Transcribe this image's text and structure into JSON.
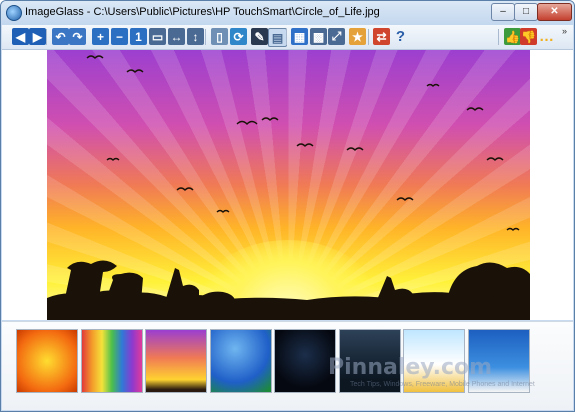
{
  "window": {
    "title": "ImageGlass - C:\\Users\\Public\\Pictures\\HP TouchSmart\\Circle_of_Life.jpg",
    "minimize_glyph": "–",
    "maximize_glyph": "□",
    "close_glyph": "✕"
  },
  "toolbar": {
    "overflow_glyph": "»",
    "buttons": [
      {
        "name": "back-icon",
        "glyph": "◀",
        "color": "#1f5fb5"
      },
      {
        "name": "forward-icon",
        "glyph": "▶",
        "color": "#1f5fb5"
      },
      {
        "name": "rotate-left-icon",
        "glyph": "↶",
        "color": "#3a76c4"
      },
      {
        "name": "rotate-right-icon",
        "glyph": "↷",
        "color": "#3a76c4"
      },
      {
        "name": "zoom-in-icon",
        "glyph": "+",
        "color": "#2b6fc2"
      },
      {
        "name": "zoom-out-icon",
        "glyph": "−",
        "color": "#2b6fc2"
      },
      {
        "name": "actual-size-icon",
        "glyph": "1",
        "color": "#2b6fc2"
      },
      {
        "name": "lock-zoom-icon",
        "glyph": "▭",
        "color": "#4a6a93"
      },
      {
        "name": "fit-width-icon",
        "glyph": "↔",
        "color": "#4a6a93"
      },
      {
        "name": "fit-height-icon",
        "glyph": "↕",
        "color": "#4a6a93"
      },
      {
        "name": "open-folder-icon",
        "glyph": "▯",
        "color": "#6f8fb5"
      },
      {
        "name": "refresh-icon",
        "glyph": "⟳",
        "color": "#2f86c9"
      },
      {
        "name": "edit-icon",
        "glyph": "✎",
        "color": "#2a3950"
      },
      {
        "name": "view-mode-icon",
        "glyph": "▤",
        "color": "#4a6a93"
      },
      {
        "name": "thumbnail-grid-icon",
        "glyph": "▦",
        "color": "#2f70c8"
      },
      {
        "name": "checkerboard-icon",
        "glyph": "▩",
        "color": "#4a6a93"
      },
      {
        "name": "fullscreen-icon",
        "glyph": "⤢",
        "color": "#4a6a93"
      },
      {
        "name": "slideshow-icon",
        "glyph": "★",
        "color": "#e6a23a"
      },
      {
        "name": "convert-icon",
        "glyph": "⇄",
        "color": "#d0452d"
      },
      {
        "name": "help-icon",
        "glyph": "?",
        "color": "#2a5ea8"
      },
      {
        "name": "like-icon",
        "glyph": "👍",
        "color": "#3c9b3c"
      },
      {
        "name": "dislike-icon",
        "glyph": "👎",
        "color": "#d03a2a"
      },
      {
        "name": "feedback-icon",
        "glyph": "…",
        "color": "#f0b020"
      }
    ]
  },
  "thumbnails": [
    {
      "name": "thumbnail-orange-pattern",
      "bg": "radial-gradient(circle,#ffdd30,#f36a10 70%,#c93a00)"
    },
    {
      "name": "thumbnail-rainbow-stripes",
      "bg": "linear-gradient(90deg,#e23a3a,#f39a2a,#f5e23a,#4bbf4b,#2f7ad6,#8a3ad0,#e23a9a)"
    },
    {
      "name": "thumbnail-circle-of-life",
      "bg": "linear-gradient(#9b3fd0,#f07a55 45%,#ffd330 80%,#2a1a10 96%)"
    },
    {
      "name": "thumbnail-blue-waves",
      "bg": "radial-gradient(circle at 40% 30%,#6fb6f0,#1f5fc8 60%,#1d8a3a 95%)"
    },
    {
      "name": "thumbnail-dark-abstract",
      "bg": "radial-gradient(circle at 50% 40%,#1b2e4a,#050810 70%)"
    },
    {
      "name": "thumbnail-night-forest",
      "bg": "linear-gradient(#2d4158,#0c1722 80%)"
    },
    {
      "name": "thumbnail-cartoon-sky",
      "bg": "linear-gradient(#bfe6ff,#ffffff 55%,#f0c040 100%)"
    },
    {
      "name": "thumbnail-blue-cartoon",
      "bg": "linear-gradient(#1d5fc0,#3c8fe0 60%,#f5f5f5 100%)"
    }
  ],
  "watermark": {
    "site": "Pinnaley.com",
    "tagline": "Tech Tips, Windows, Freeware, Mobile Phones and Internet"
  }
}
